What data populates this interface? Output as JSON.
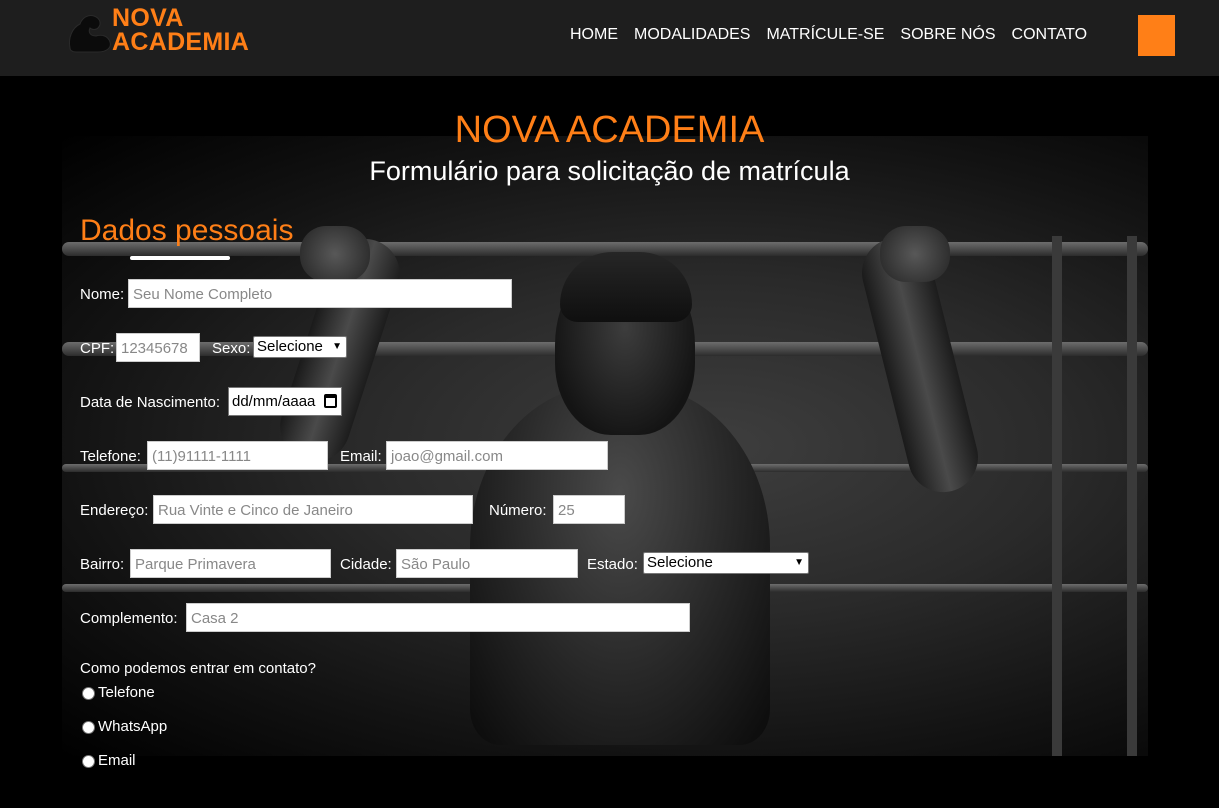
{
  "brand": {
    "line1": "NOVA",
    "line2": "ACADEMIA"
  },
  "nav": {
    "items": [
      "HOME",
      "MODALIDADES",
      "MATRÍCULE-SE",
      "SOBRE NÓS",
      "CONTATO"
    ]
  },
  "colors": {
    "accent": "#ff7f17",
    "navbar": "#1e1e1e",
    "background": "#000000"
  },
  "header": {
    "title": "NOVA ACADEMIA",
    "subtitle": "Formulário para solicitação de matrícula"
  },
  "form": {
    "section_title": "Dados pessoais",
    "nome": {
      "label": "Nome:",
      "placeholder": "Seu Nome Completo"
    },
    "cpf": {
      "label": "CPF:",
      "placeholder": "12345678"
    },
    "sexo": {
      "label": "Sexo:",
      "value": "Selecione"
    },
    "nascimento": {
      "label": "Data de Nascimento:",
      "value": "dd/mm/aaaa"
    },
    "telefone": {
      "label": "Telefone:",
      "placeholder": "(11)91111-1111"
    },
    "email": {
      "label": "Email:",
      "placeholder": "joao@gmail.com"
    },
    "endereco": {
      "label": "Endereço:",
      "placeholder": "Rua Vinte e Cinco de Janeiro"
    },
    "numero": {
      "label": "Número:",
      "placeholder": "25"
    },
    "bairro": {
      "label": "Bairro:",
      "placeholder": "Parque Primavera"
    },
    "cidade": {
      "label": "Cidade:",
      "placeholder": "São Paulo"
    },
    "estado": {
      "label": "Estado:",
      "value": "Selecione"
    },
    "complemento": {
      "label": "Complemento:",
      "placeholder": "Casa 2"
    },
    "contato": {
      "question": "Como podemos entrar em contato?",
      "options": [
        "Telefone",
        "WhatsApp",
        "Email"
      ]
    }
  }
}
